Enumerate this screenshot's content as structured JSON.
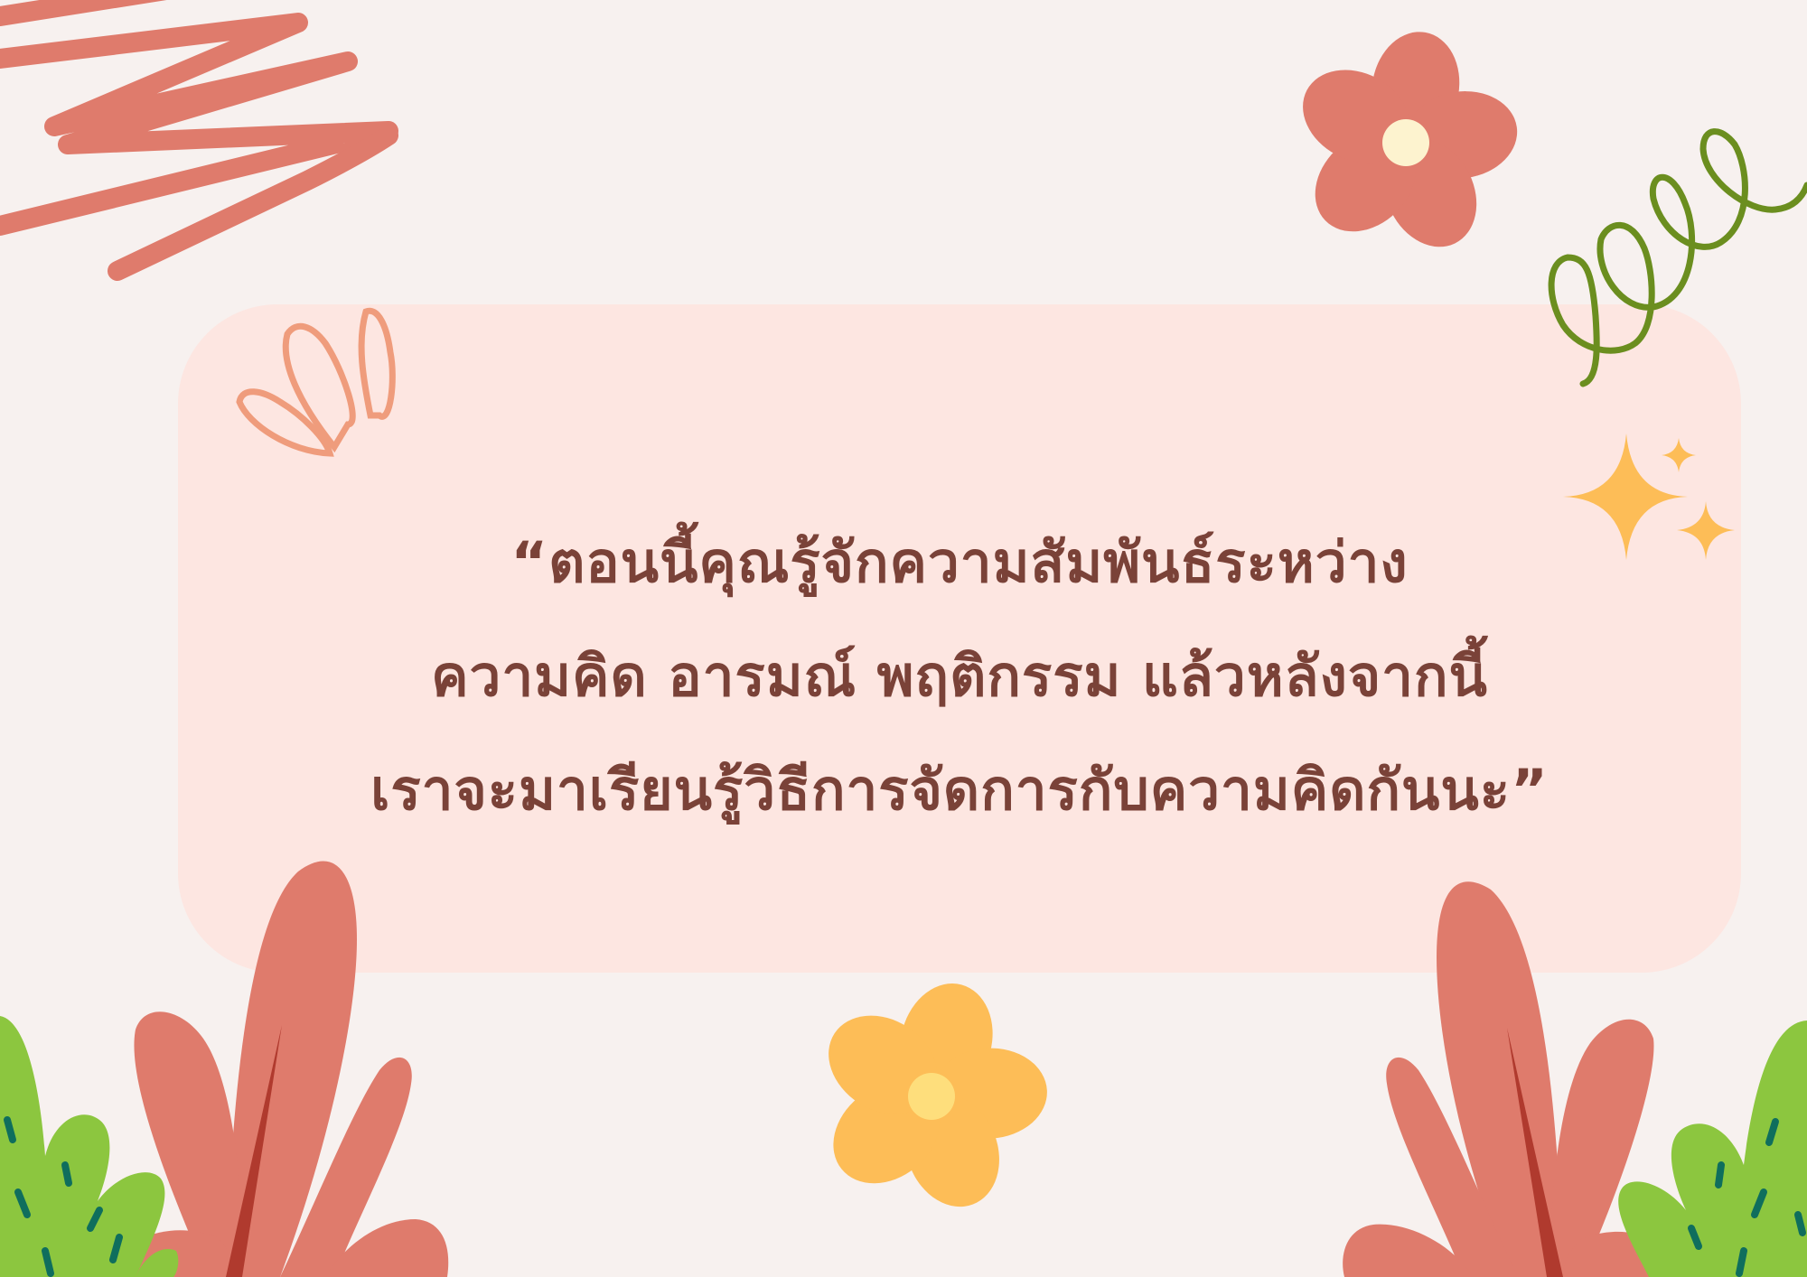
{
  "quote": {
    "lines": [
      "“ตอนนี้คุณรู้จักความสัมพันธ์ระหว่าง",
      "ความคิด อารมณ์ พฤติกรรม แล้วหลังจากนี้",
      "เราจะมาเรียนรู้วิธีการจัดการกับความคิดกันนะ”"
    ]
  },
  "colors": {
    "background": "#f7f1ef",
    "panel": "#fde6e1",
    "text": "#7a4238",
    "coral": "#df7b6c",
    "yellow": "#fdbd57",
    "green": "#8cc63f",
    "olive": "#6b8e1f",
    "dark_red": "#b03a2e"
  },
  "icons": [
    "scribble-lines",
    "pink-flower-icon",
    "green-spring-swirl",
    "sparkle-stars-icon",
    "leaf-outline-icon",
    "yellow-flower-icon",
    "coral-bush-left",
    "coral-bush-right",
    "green-bush-left",
    "green-bush-right"
  ]
}
